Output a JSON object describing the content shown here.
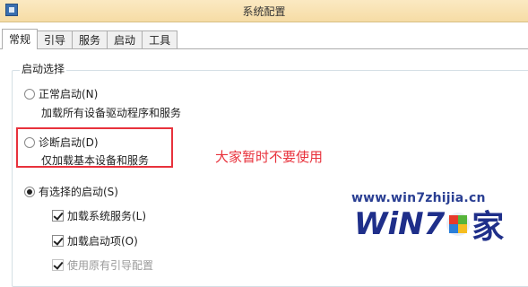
{
  "window": {
    "title": "系统配置"
  },
  "tabs": [
    {
      "label": "常规",
      "active": true
    },
    {
      "label": "引导",
      "active": false
    },
    {
      "label": "服务",
      "active": false
    },
    {
      "label": "启动",
      "active": false
    },
    {
      "label": "工具",
      "active": false
    }
  ],
  "startup": {
    "group_title": "启动选择",
    "normal": {
      "label": "正常启动(N)",
      "desc": "加载所有设备驱动程序和服务",
      "checked": false
    },
    "diagnostic": {
      "label": "诊断启动(D)",
      "desc": "仅加载基本设备和服务",
      "checked": false
    },
    "selective": {
      "label": "有选择的启动(S)",
      "checked": true,
      "options": [
        {
          "label": "加载系统服务(L)",
          "checked": true
        },
        {
          "label": "加载启动项(O)",
          "checked": true
        },
        {
          "label": "使用原有引导配置",
          "checked": true,
          "disabled": true
        }
      ]
    }
  },
  "annotation": {
    "text": "大家暂时不要使用",
    "color": "#e8323c"
  },
  "watermark": {
    "url": "www.win7zhijia.cn",
    "logo_text": "WiN7",
    "logo_char": "家"
  }
}
